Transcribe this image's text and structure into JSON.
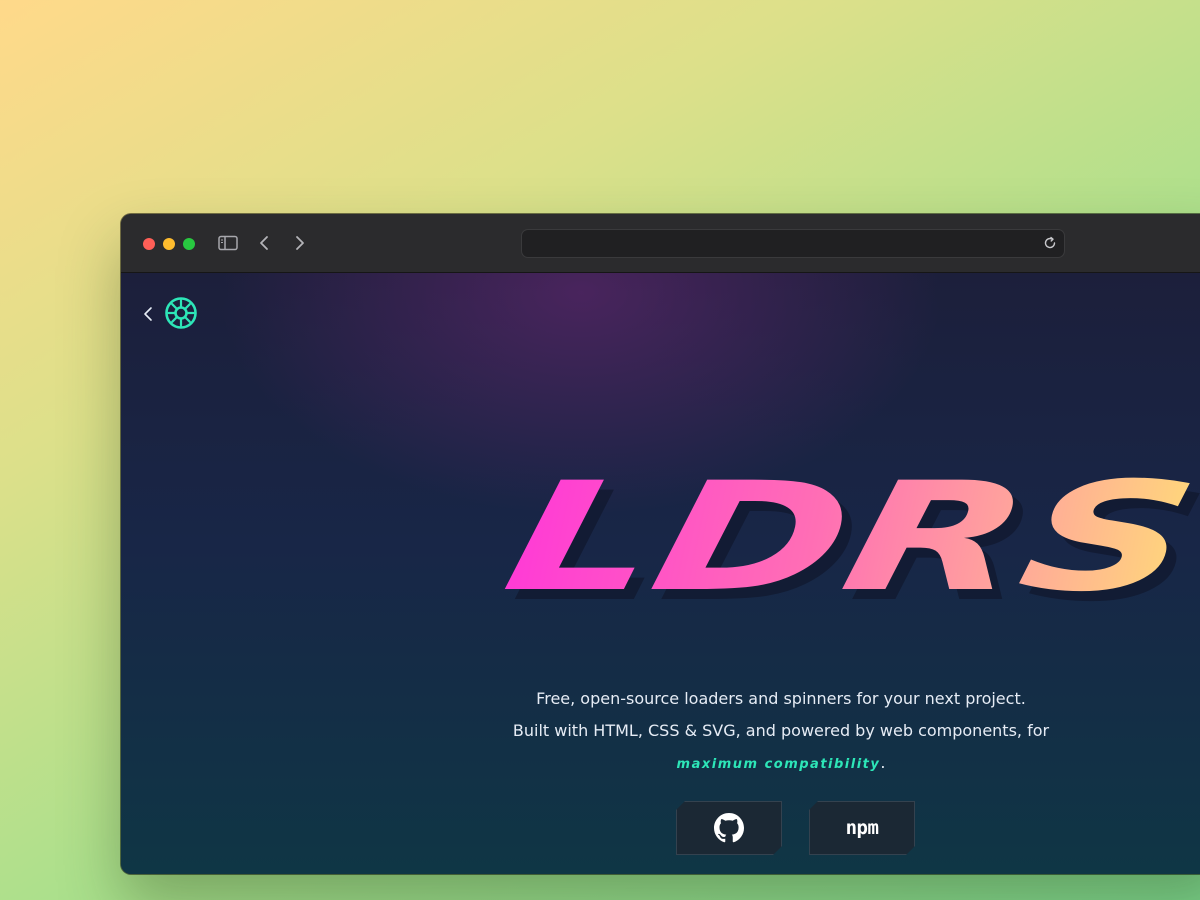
{
  "browser": {
    "address": "",
    "icons": [
      "sidebar-icon",
      "chevron-left-icon",
      "chevron-right-icon",
      "reload-icon"
    ]
  },
  "page": {
    "logo_icon": "ldrs-logo-icon",
    "hero_title": "LDRS",
    "tagline": {
      "line1": "Free, open-source loaders and spinners for your next project.",
      "line2": "Built with HTML, CSS & SVG, and powered by web components, for",
      "accent": "maximum compatibility",
      "end_punct": "."
    },
    "buttons": {
      "github_icon": "github-icon",
      "npm_label": "npm"
    }
  },
  "colors": {
    "accent": "#2de6b8",
    "gradient_start": "#ff3ad6",
    "gradient_end": "#ffd87a",
    "background": "#182647"
  }
}
